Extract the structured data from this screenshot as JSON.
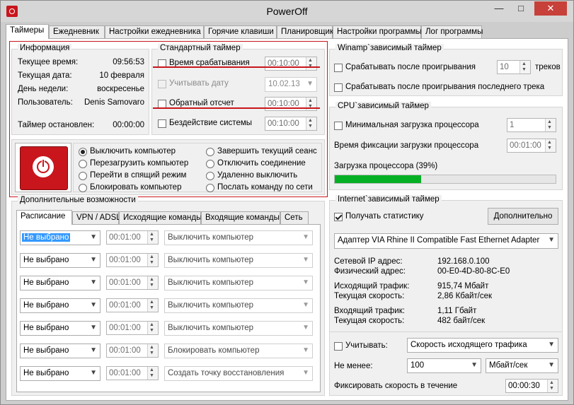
{
  "window": {
    "title": "PowerOff",
    "minimize": "—",
    "maximize": "□",
    "close": "✕"
  },
  "tabs": [
    "Таймеры",
    "Ежедневник",
    "Настройки ежедневника",
    "Горячие клавиши",
    "Планировщик",
    "Настройки программы",
    "Лог программы"
  ],
  "info": {
    "title": "Информация",
    "rows": [
      {
        "label": "Текущее время:",
        "value": "09:56:53"
      },
      {
        "label": "Текущая дата:",
        "value": "10 февраля"
      },
      {
        "label": "День недели:",
        "value": "воскресенье"
      },
      {
        "label": "Пользователь:",
        "value": "Denis Samovaro"
      }
    ],
    "timer_label": "Таймер остановлен:",
    "timer_value": "00:00:00"
  },
  "standard": {
    "title": "Стандартный таймер",
    "trigger_time_label": "Время срабатывания",
    "trigger_time_value": "00:10:00",
    "date_label": "Учитывать дату",
    "date_value": "10.02.13",
    "countdown_label": "Обратный отсчет",
    "countdown_value": "00:10:00",
    "idle_label": "Бездействие системы",
    "idle_value": "00:10:00"
  },
  "actions": {
    "left": [
      "Выключить компьютер",
      "Перезагрузить компьютер",
      "Перейти в спящий режим",
      "Блокировать компьютер"
    ],
    "right": [
      "Завершить текущий сеанс",
      "Отключить соединение",
      "Удаленно выключить",
      "Послать команду по сети"
    ]
  },
  "winamp": {
    "title": "Winamp`зависимый таймер",
    "after_play_label": "Срабатывать после проигрывания",
    "tracks_value": "10",
    "tracks_label": "треков",
    "last_track_label": "Срабатывать после проигрывания последнего трека"
  },
  "cpu": {
    "title": "CPU`зависимый таймер",
    "min_load_label": "Минимальная загрузка процессора",
    "min_load_value": "1",
    "fix_time_label": "Время фиксации загрузки процессора",
    "fix_time_value": "00:01:00",
    "load_label": "Загрузка процессора (39%)",
    "load_fraction": 0.39
  },
  "extra": {
    "title": "Дополнительные возможности",
    "tabs": [
      "Расписание",
      "VPN / ADSL",
      "Исходящие команды",
      "Входящие команды",
      "Сеть"
    ],
    "rows": [
      {
        "select": "Не выбрано",
        "time": "00:01:00",
        "action": "Выключить компьютер"
      },
      {
        "select": "Не выбрано",
        "time": "00:01:00",
        "action": "Выключить компьютер"
      },
      {
        "select": "Не выбрано",
        "time": "00:01:00",
        "action": "Выключить компьютер"
      },
      {
        "select": "Не выбрано",
        "time": "00:01:00",
        "action": "Выключить компьютер"
      },
      {
        "select": "Не выбрано",
        "time": "00:01:00",
        "action": "Выключить компьютер"
      },
      {
        "select": "Не выбрано",
        "time": "00:01:00",
        "action": "Блокировать компьютер"
      },
      {
        "select": "Не выбрано",
        "time": "00:01:00",
        "action": "Создать точку восстановления"
      }
    ]
  },
  "internet": {
    "title": "Internet`зависимый таймер",
    "stats_label": "Получать статистику",
    "more_button": "Дополнительно",
    "adapter": "Адаптер VIA Rhine II Compatible Fast Ethernet Adapter",
    "ip_label": "Сетевой IP адрес:",
    "ip_value": "192.168.0.100",
    "mac_label": "Физический адрес:",
    "mac_value": "00-E0-4D-80-8C-E0",
    "out_label": "Исходящий трафик:",
    "out_value": "915,74 Мбайт",
    "out_speed_label": "Текущая скорость:",
    "out_speed_value": "2,86 Кбайт/сек",
    "in_label": "Входящий трафик:",
    "in_value": "1,11 Гбайт",
    "in_speed_label": "Текущая скорость:",
    "in_speed_value": "482 байт/сек",
    "account_label": "Учитывать:",
    "account_value": "Скорость исходящего трафика",
    "min_label": "Не менее:",
    "min_value": "100",
    "unit_value": "Мбайт/сек",
    "fix_label": "Фиксировать скорость в течение",
    "fix_value": "00:00:30"
  },
  "colors": {
    "accent_red": "#c8161c",
    "progress_green": "#06b025",
    "selection": "#3399ff"
  }
}
